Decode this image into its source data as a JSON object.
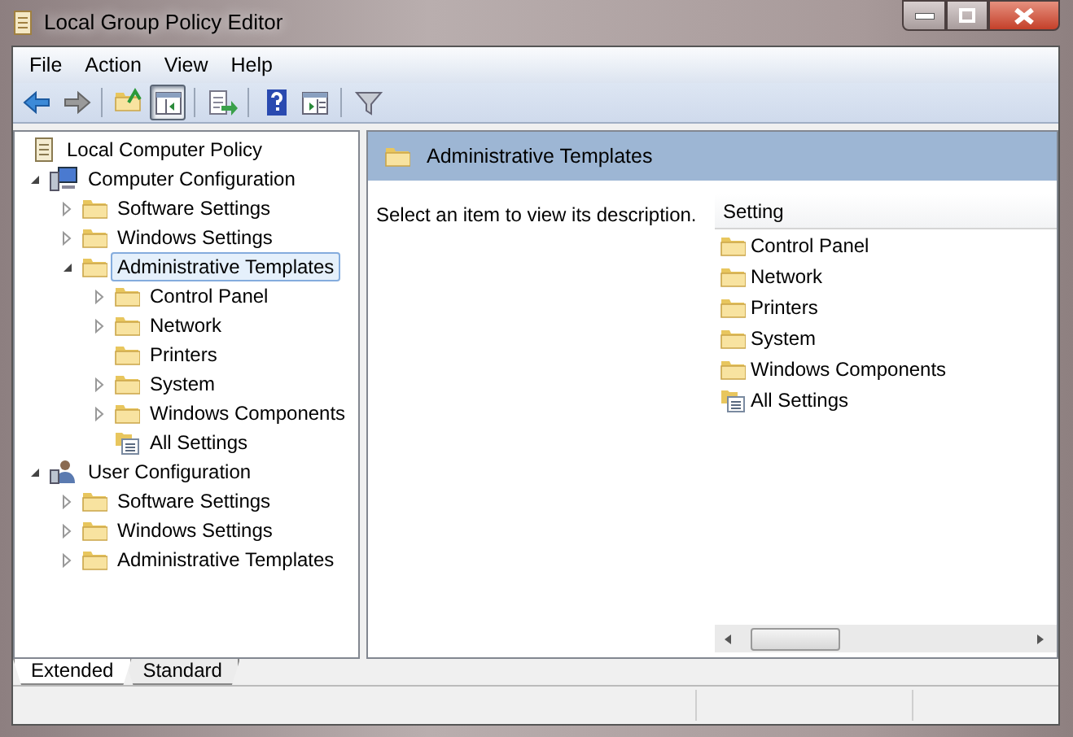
{
  "window": {
    "title": "Local Group Policy Editor"
  },
  "menu": [
    "File",
    "Action",
    "View",
    "Help"
  ],
  "toolbar": [
    [
      {
        "kind": "back",
        "pressed": false
      },
      {
        "kind": "forward",
        "pressed": false
      }
    ],
    [
      {
        "kind": "upfolder",
        "pressed": false
      },
      {
        "kind": "tree",
        "pressed": true
      }
    ],
    [
      {
        "kind": "export",
        "pressed": false
      }
    ],
    [
      {
        "kind": "help",
        "pressed": false
      },
      {
        "kind": "actionpane",
        "pressed": false
      }
    ],
    [
      {
        "kind": "filter",
        "pressed": false
      }
    ]
  ],
  "tree": [
    {
      "label": "Local Computer Policy",
      "kind": "policy",
      "selected": false,
      "children": [
        {
          "label": "Computer Configuration",
          "kind": "computer",
          "expandable": true,
          "expanded": true,
          "selected": false,
          "children": [
            {
              "label": "Software Settings",
              "kind": "folder",
              "expandable": true,
              "expanded": false,
              "selected": false
            },
            {
              "label": "Windows Settings",
              "kind": "folder",
              "expandable": true,
              "expanded": false,
              "selected": false
            },
            {
              "label": "Administrative Templates",
              "kind": "folder",
              "expandable": true,
              "expanded": true,
              "selected": true,
              "children": [
                {
                  "label": "Control Panel",
                  "kind": "folder",
                  "expandable": true,
                  "expanded": false,
                  "selected": false
                },
                {
                  "label": "Network",
                  "kind": "folder",
                  "expandable": true,
                  "expanded": false,
                  "selected": false
                },
                {
                  "label": "Printers",
                  "kind": "folder",
                  "expandable": false,
                  "selected": false
                },
                {
                  "label": "System",
                  "kind": "folder",
                  "expandable": true,
                  "expanded": false,
                  "selected": false
                },
                {
                  "label": "Windows Components",
                  "kind": "folder",
                  "expandable": true,
                  "expanded": false,
                  "selected": false
                },
                {
                  "label": "All Settings",
                  "kind": "allsettings",
                  "expandable": false,
                  "selected": false
                }
              ]
            }
          ]
        },
        {
          "label": "User Configuration",
          "kind": "user",
          "expandable": true,
          "expanded": true,
          "selected": false,
          "children": [
            {
              "label": "Software Settings",
              "kind": "folder",
              "expandable": true,
              "expanded": false,
              "selected": false
            },
            {
              "label": "Windows Settings",
              "kind": "folder",
              "expandable": true,
              "expanded": false,
              "selected": false
            },
            {
              "label": "Administrative Templates",
              "kind": "folder",
              "expandable": true,
              "expanded": false,
              "selected": false
            }
          ]
        }
      ]
    }
  ],
  "details": {
    "title": "Administrative Templates",
    "description": "Select an item to view its description.",
    "column": "Setting",
    "items": [
      {
        "label": "Control Panel",
        "kind": "folder"
      },
      {
        "label": "Network",
        "kind": "folder"
      },
      {
        "label": "Printers",
        "kind": "folder"
      },
      {
        "label": "System",
        "kind": "folder"
      },
      {
        "label": "Windows Components",
        "kind": "folder"
      },
      {
        "label": "All Settings",
        "kind": "allsettings"
      }
    ]
  },
  "tabs": [
    {
      "label": "Extended",
      "selected": true
    },
    {
      "label": "Standard",
      "selected": false
    }
  ]
}
